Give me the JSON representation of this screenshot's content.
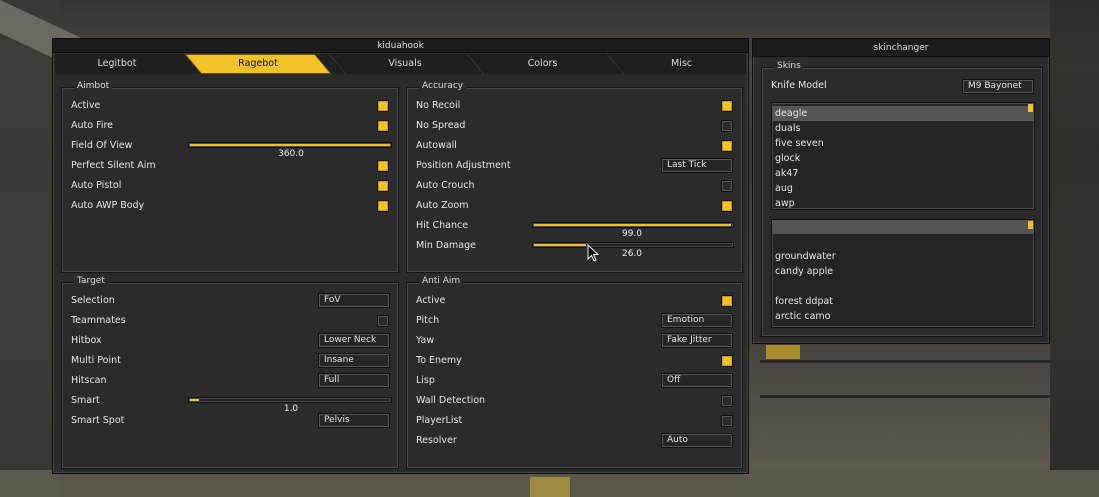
{
  "main_window": {
    "title": "kiduahook",
    "tabs": [
      "Legitbot",
      "Ragebot",
      "Visuals",
      "Colors",
      "Misc"
    ],
    "active_tab": "Ragebot"
  },
  "aimbot": {
    "title": "Aimbot",
    "active": "Active",
    "auto_fire": "Auto Fire",
    "fov_label": "Field Of View",
    "fov_value": "360.0",
    "fov_fraction": 1.0,
    "perfect_silent": "Perfect Silent Aim",
    "auto_pistol": "Auto Pistol",
    "auto_awp": "Auto AWP Body"
  },
  "accuracy": {
    "title": "Accuracy",
    "no_recoil": "No Recoil",
    "no_spread": "No Spread",
    "autowall": "Autowall",
    "position_adjustment": "Position Adjustment",
    "position_adjustment_value": "Last Tick",
    "auto_crouch": "Auto Crouch",
    "auto_zoom": "Auto Zoom",
    "hit_chance": "Hit Chance",
    "hit_chance_value": "99.0",
    "hit_chance_fraction": 0.99,
    "min_damage": "Min Damage",
    "min_damage_value": "26.0",
    "min_damage_fraction": 0.26
  },
  "target": {
    "title": "Target",
    "selection": "Selection",
    "selection_value": "FoV",
    "teammates": "Teammates",
    "hitbox": "Hitbox",
    "hitbox_value": "Lower Neck",
    "multi_point": "Multi Point",
    "multi_point_value": "Insane",
    "hitscan": "Hitscan",
    "hitscan_value": "Full",
    "smart": "Smart",
    "smart_value": "1.0",
    "smart_fraction": 0.05,
    "smart_spot": "Smart Spot",
    "smart_spot_value": "Pelvis"
  },
  "anti_aim": {
    "title": "Anti Aim",
    "active": "Active",
    "pitch": "Pitch",
    "pitch_value": "Emotion",
    "yaw": "Yaw",
    "yaw_value": "Fake Jitter",
    "to_enemy": "To Enemy",
    "lisp": "Lisp",
    "lisp_value": "Off",
    "wall_detection": "Wall Detection",
    "player_list": "PlayerList",
    "resolver": "Resolver",
    "resolver_value": "Auto"
  },
  "skinchanger": {
    "title": "skinchanger",
    "group_title": "Skins",
    "knife_label": "Knife Model",
    "knife_value": "M9 Bayonet",
    "weapons": [
      "deagle",
      "duals",
      "five seven",
      "glock",
      "ak47",
      "aug",
      "awp"
    ],
    "selected_weapon": "deagle",
    "skins": [
      "",
      "",
      "groundwater",
      "candy apple",
      "",
      "forest ddpat",
      "arctic camo"
    ]
  },
  "colors": {
    "accent": "#f2c227",
    "panel": "#2b2b2b",
    "title_bar": "#1c1c1c"
  }
}
